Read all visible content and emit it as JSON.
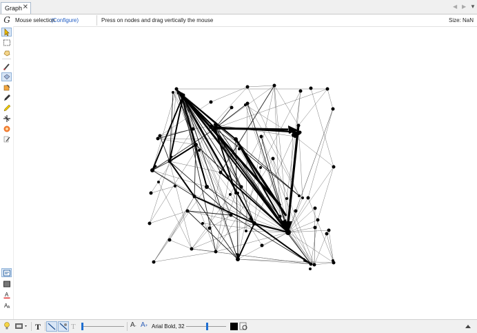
{
  "tab": {
    "title": "Graph",
    "close_glyph": "✕"
  },
  "tab_nav": {
    "prev_glyph": "◀",
    "next_glyph": "▶",
    "menu_glyph": "▼"
  },
  "infobar": {
    "mode_label": "Mouse selection",
    "configure_link": "(Configure)",
    "hint": "Press on nodes and drag vertically the mouse",
    "size_label": "Size: NaN"
  },
  "left_tools": [
    {
      "name": "select-arrow-icon",
      "active": true
    },
    {
      "name": "rectangle-select-icon",
      "active": false
    },
    {
      "name": "drag-hand-icon",
      "active": false
    },
    {
      "name": "brush-icon",
      "active": false
    },
    {
      "name": "painter-icon",
      "active": true
    },
    {
      "name": "node-color-icon",
      "active": false
    },
    {
      "name": "pencil-icon",
      "active": false
    },
    {
      "name": "edge-pencil-icon",
      "active": false
    },
    {
      "name": "shortest-path-icon",
      "active": false
    },
    {
      "name": "heatmap-icon",
      "active": false
    },
    {
      "name": "edit-node-icon",
      "active": false
    }
  ],
  "left_bottom_tools": [
    {
      "name": "node-label-icon",
      "active": true
    },
    {
      "name": "background-color-icon",
      "active": false
    },
    {
      "name": "text-color-icon",
      "active": false
    },
    {
      "name": "text-size-icon",
      "active": false
    }
  ],
  "bottom_toolbar": {
    "font_label": "Arial Bold, 32",
    "font_decrease_glyph": "A",
    "font_increase_glyph": "A",
    "edge_slider_fraction": 0.0,
    "font_slider_fraction": 0.5,
    "label_color": "#000000"
  },
  "colors": {
    "accent": "#1f6fd1",
    "link": "#1f5cc4",
    "active_bg": "#d8e6f6",
    "node": "#000000"
  }
}
